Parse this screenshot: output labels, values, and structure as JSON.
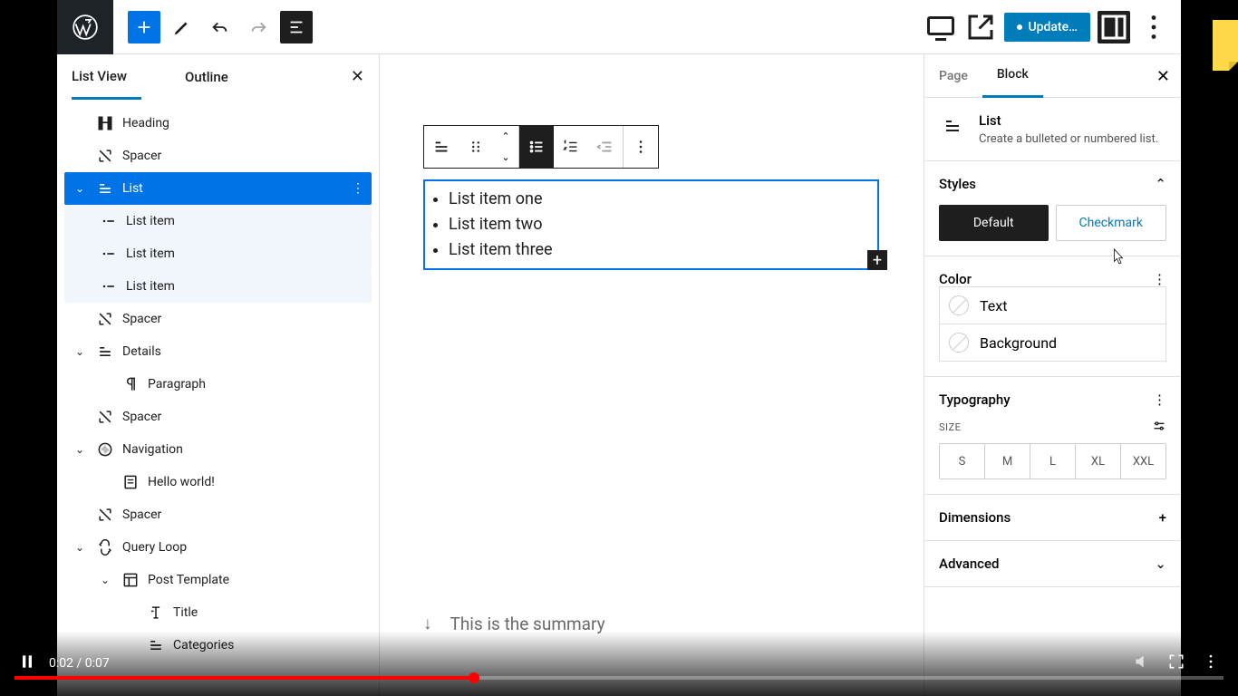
{
  "topbar": {
    "update_label": "Update…"
  },
  "left_panel": {
    "tabs": {
      "list_view": "List View",
      "outline": "Outline"
    },
    "items": [
      {
        "label": "Heading",
        "icon": "heading"
      },
      {
        "label": "Spacer",
        "icon": "spacer"
      },
      {
        "label": "List",
        "icon": "list",
        "selected": true,
        "expanded": true
      },
      {
        "label": "List item",
        "icon": "listitem",
        "sub": true
      },
      {
        "label": "List item",
        "icon": "listitem",
        "sub": true
      },
      {
        "label": "List item",
        "icon": "listitem",
        "sub": true
      },
      {
        "label": "Spacer",
        "icon": "spacer"
      },
      {
        "label": "Details",
        "icon": "details",
        "expanded": true
      },
      {
        "label": "Paragraph",
        "icon": "paragraph",
        "indent": 1
      },
      {
        "label": "Spacer",
        "icon": "spacer"
      },
      {
        "label": "Navigation",
        "icon": "navigation",
        "expanded": true
      },
      {
        "label": "Hello world!",
        "icon": "page",
        "indent": 1
      },
      {
        "label": "Spacer",
        "icon": "spacer"
      },
      {
        "label": "Query Loop",
        "icon": "loop",
        "expanded": true
      },
      {
        "label": "Post Template",
        "icon": "template",
        "indent": 1,
        "expanded": true
      },
      {
        "label": "Title",
        "icon": "title",
        "indent": 2
      },
      {
        "label": "Categories",
        "icon": "categories",
        "indent": 2
      }
    ]
  },
  "canvas": {
    "list_items": [
      "List item one",
      "List item two",
      "List item three"
    ],
    "summary_text": "This is the summary"
  },
  "right_panel": {
    "tabs": {
      "page": "Page",
      "block": "Block"
    },
    "block_title": "List",
    "block_desc": "Create a bulleted or numbered list.",
    "styles": {
      "heading": "Styles",
      "default": "Default",
      "checkmark": "Checkmark"
    },
    "color": {
      "heading": "Color",
      "text": "Text",
      "background": "Background"
    },
    "typography": {
      "heading": "Typography",
      "size_label": "SIZE",
      "sizes": [
        "S",
        "M",
        "L",
        "XL",
        "XXL"
      ]
    },
    "dimensions": {
      "heading": "Dimensions"
    },
    "advanced": {
      "heading": "Advanced"
    }
  },
  "video": {
    "time": "0:02 / 0:07"
  }
}
